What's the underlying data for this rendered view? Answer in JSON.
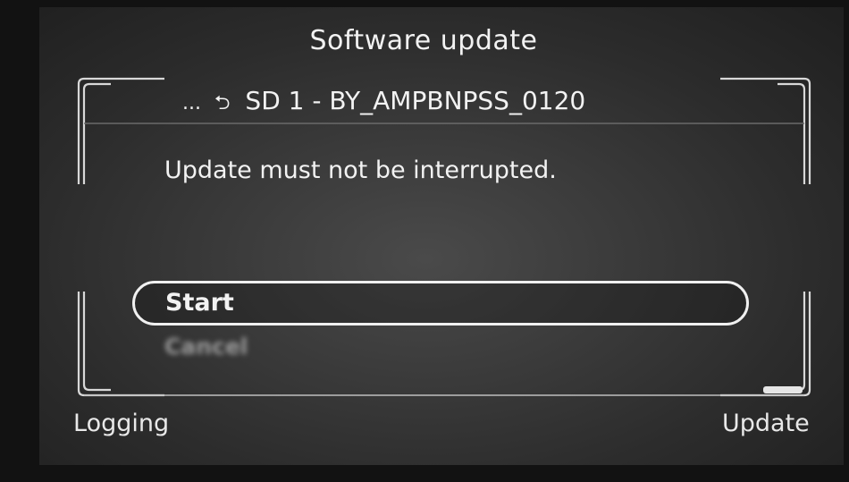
{
  "screen": {
    "title": "Software update",
    "path": {
      "ellipsis": "...",
      "back_icon": "return-arrow-icon",
      "label": "SD 1 - BY_AMPBNPSS_0120"
    },
    "message": "Update must not be interrupted.",
    "options": {
      "start_label": "Start",
      "cancel_label": "Cancel"
    },
    "softkeys": {
      "left_label": "Logging",
      "right_label": "Update"
    }
  }
}
